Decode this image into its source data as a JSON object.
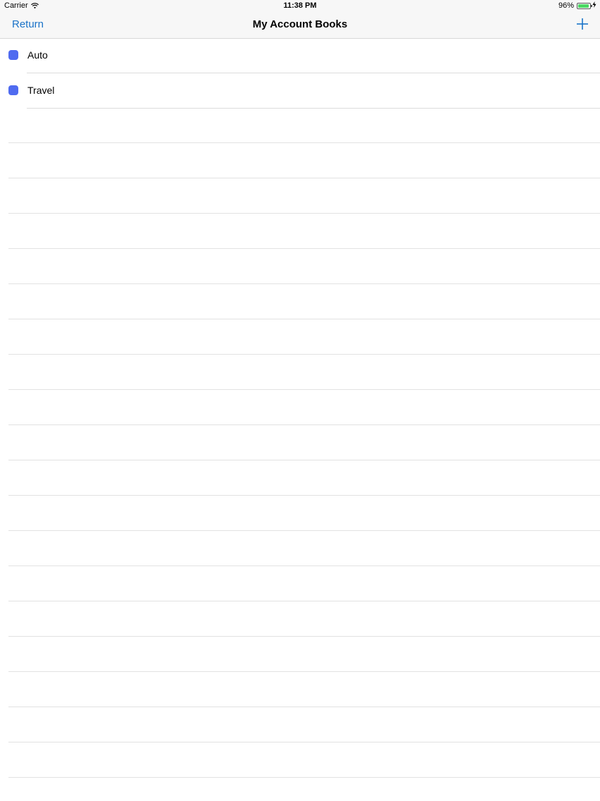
{
  "status_bar": {
    "carrier": "Carrier",
    "time": "11:38 PM",
    "battery_percent": "96%",
    "battery_level": 0.96,
    "battery_color": "#4cd964"
  },
  "nav": {
    "back_label": "Return",
    "title": "My Account Books",
    "add_icon": "plus-icon",
    "tint_color": "#1a73c8"
  },
  "books": [
    {
      "name": "Auto",
      "color": "#4f6bf0"
    },
    {
      "name": "Travel",
      "color": "#4f6bf0"
    }
  ]
}
